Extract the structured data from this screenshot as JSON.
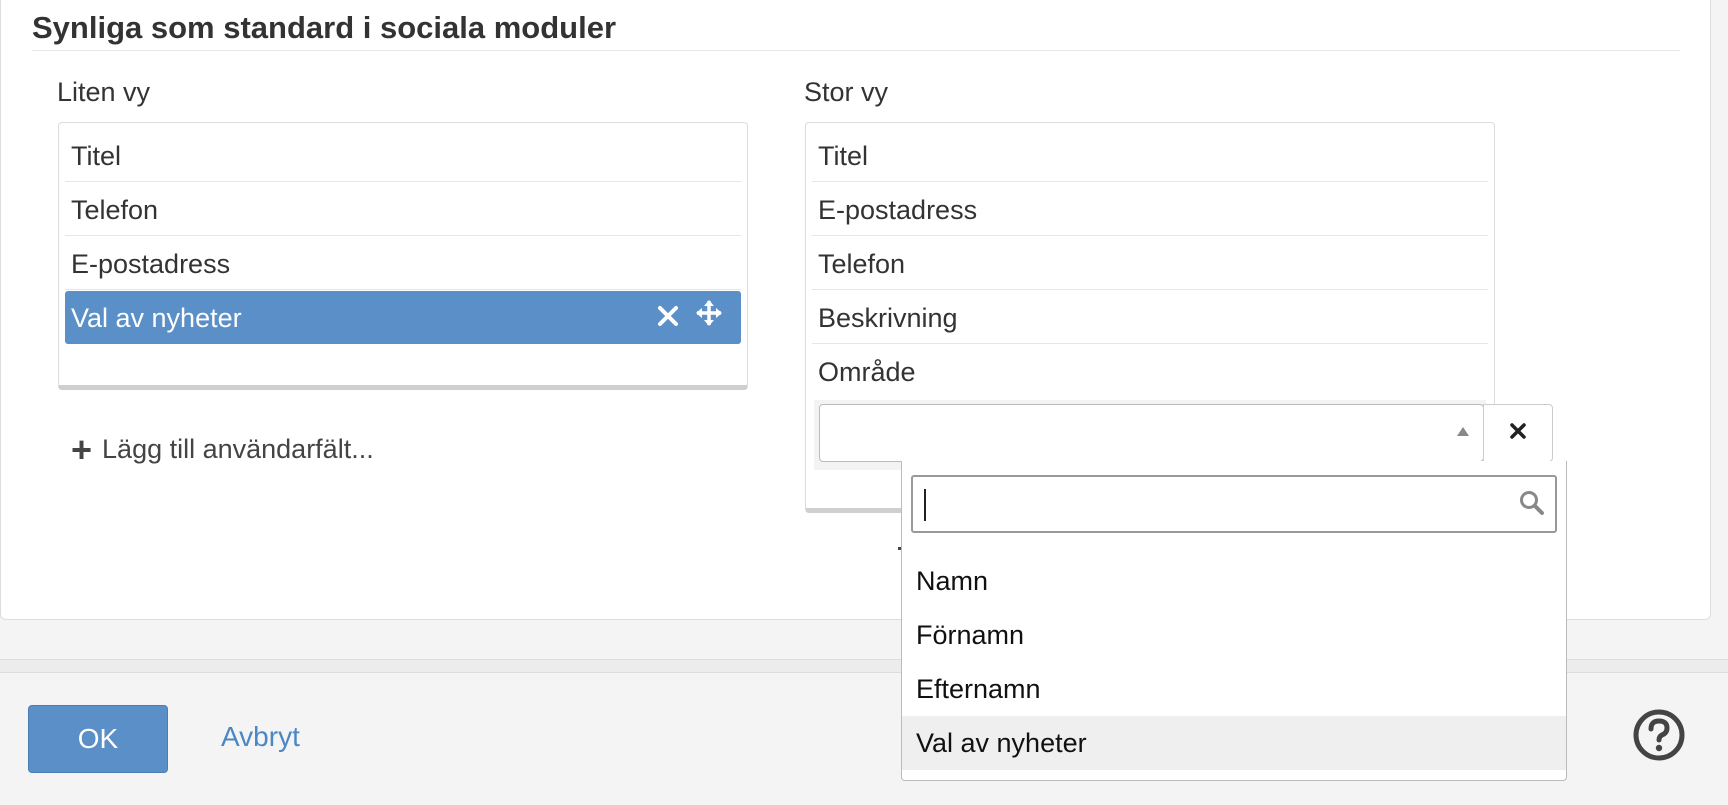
{
  "section": {
    "title": "Synliga som standard i sociala moduler"
  },
  "small_view": {
    "label": "Liten vy",
    "items": [
      {
        "label": "Titel"
      },
      {
        "label": "Telefon"
      },
      {
        "label": "E-postadress"
      },
      {
        "label": "Val av nyheter",
        "selected": true
      }
    ],
    "add_label": "Lägg till användarfält..."
  },
  "large_view": {
    "label": "Stor vy",
    "items": [
      {
        "label": "Titel"
      },
      {
        "label": "E-postadress"
      },
      {
        "label": "Telefon"
      },
      {
        "label": "Beskrivning"
      },
      {
        "label": "Område"
      }
    ],
    "select_value": ""
  },
  "dropdown": {
    "search_value": "",
    "options": [
      {
        "label": "Namn"
      },
      {
        "label": "Förnamn"
      },
      {
        "label": "Efternamn"
      },
      {
        "label": "Val av nyheter",
        "highlighted": true
      }
    ]
  },
  "footer": {
    "ok_label": "OK",
    "cancel_label": "Avbryt"
  },
  "colors": {
    "accent": "#5b8fc8",
    "link": "#4a87c5"
  },
  "icons": [
    "close-icon",
    "move-icon",
    "plus-icon",
    "search-icon",
    "help-icon",
    "caret-up-icon"
  ]
}
